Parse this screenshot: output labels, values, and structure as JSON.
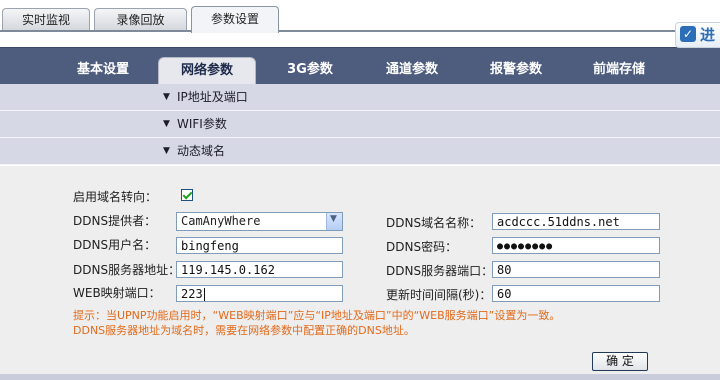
{
  "top_tabs": [
    {
      "label": "实时监视"
    },
    {
      "label": "录像回放"
    },
    {
      "label": "参数设置"
    }
  ],
  "logo": {
    "text": "进"
  },
  "nav_tabs": [
    {
      "label": "基本设置"
    },
    {
      "label": "网络参数"
    },
    {
      "label": "3G参数"
    },
    {
      "label": "通道参数"
    },
    {
      "label": "报警参数"
    },
    {
      "label": "前端存储"
    }
  ],
  "sections": [
    {
      "label": "IP地址及端口"
    },
    {
      "label": "WIFI参数"
    },
    {
      "label": "动态域名"
    }
  ],
  "form": {
    "enable_label": "启用域名转向：",
    "enabled": true,
    "provider_label": "DDNS提供者：",
    "provider_value": "CamAnyWhere",
    "domain_label": "DDNS域名名称：",
    "domain_value": "acdccc.51ddns.net",
    "user_label": "DDNS用户名：",
    "user_value": "bingfeng",
    "password_label": "DDNS密码：",
    "password_value": "●●●●●●●●",
    "server_addr_label": "DDNS服务器地址：",
    "server_addr_value": "119.145.0.162",
    "server_port_label": "DDNS服务器端口：",
    "server_port_value": "80",
    "web_port_label": "WEB映射端口：",
    "web_port_value": "223",
    "interval_label": "更新时间间隔(秒)：",
    "interval_value": "60"
  },
  "hints": [
    "提示：当UPNP功能启用时，“WEB映射端口”应与“IP地址及端口”中的“WEB服务端口”设置为一致。",
    "DDNS服务器地址为域名时，需要在网络参数中配置正确的DNS地址。"
  ],
  "ok_button": "确 定",
  "colors": {
    "nav_bg": "#4e5c7e",
    "section_bg": "#d6d8e6",
    "hint": "#e26a1b",
    "form_bg": "#eeeeee"
  }
}
